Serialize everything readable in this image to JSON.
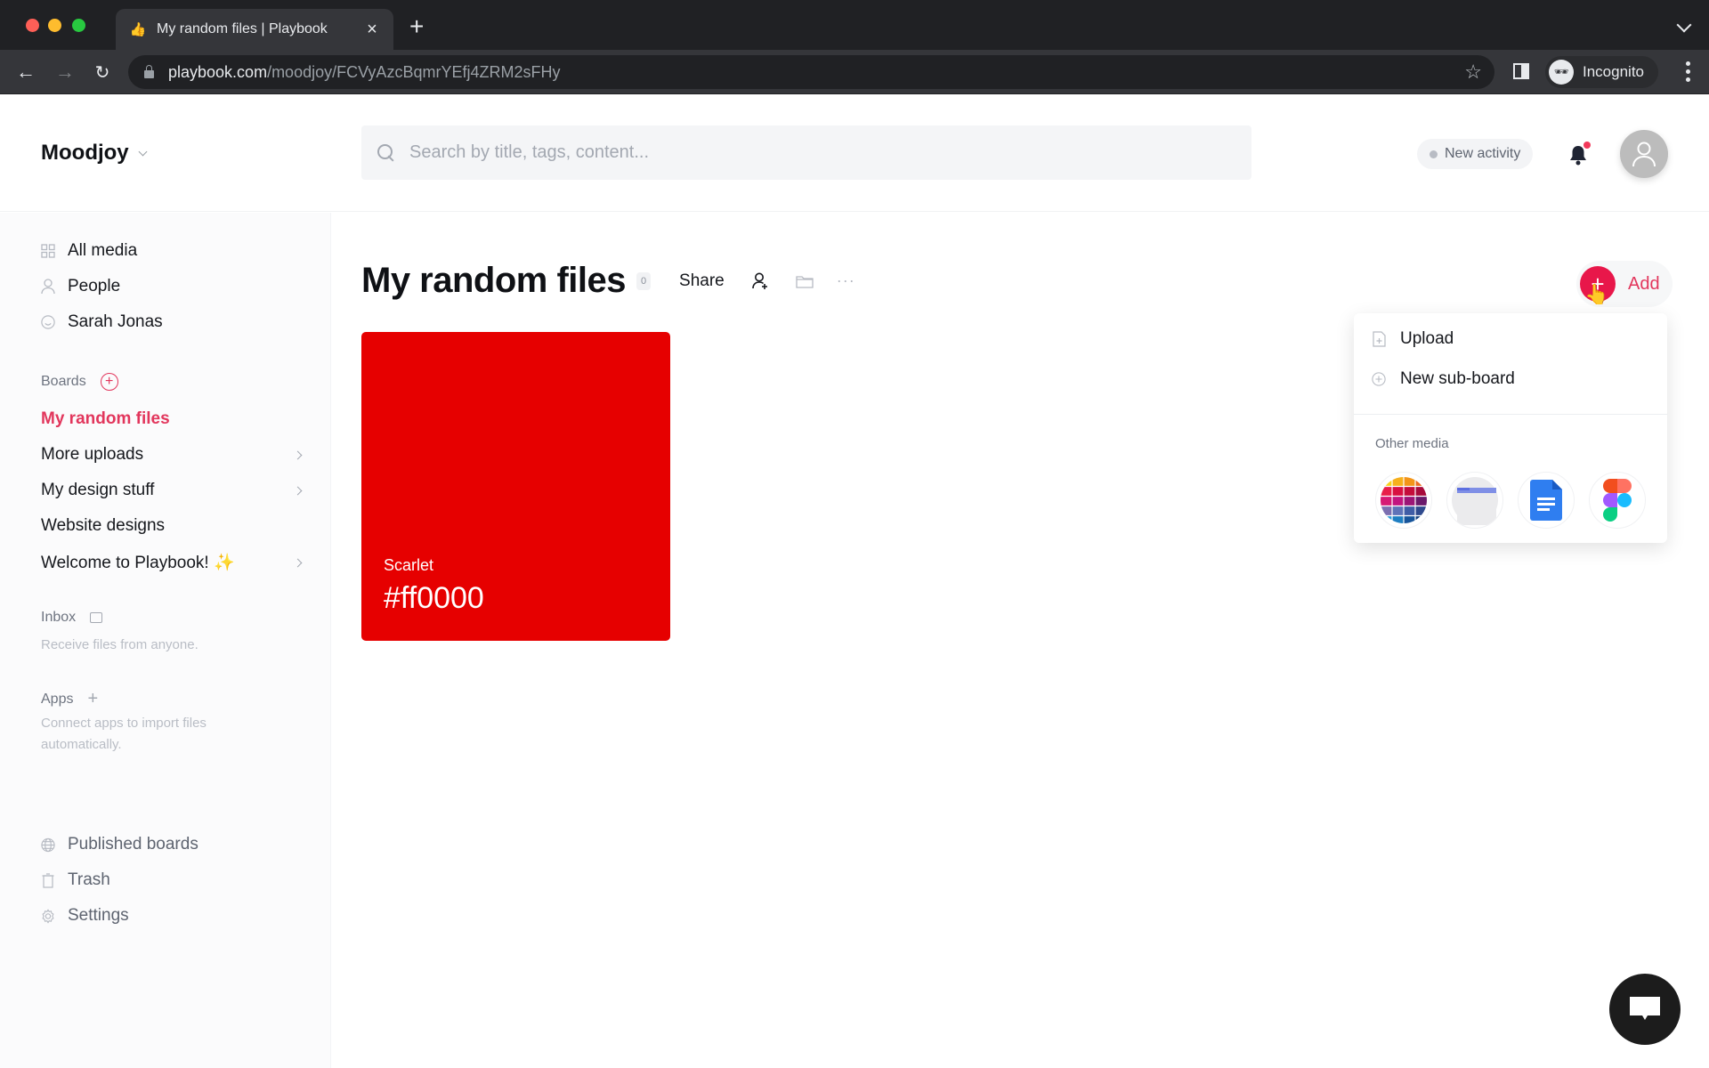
{
  "browser": {
    "tab_title": "My random files | Playbook",
    "tab_icon": "thumbs-up-icon",
    "url_host": "playbook.com",
    "url_path": "/moodjoy/FCVyAzcBqmrYEfj4ZRM2sFHy",
    "profile_label": "Incognito"
  },
  "header": {
    "workspace": "Moodjoy",
    "search_placeholder": "Search by title, tags, content...",
    "search_value": "",
    "activity_label": "New activity",
    "notification_unread": true
  },
  "sidebar": {
    "top_items": [
      {
        "label": "All media",
        "icon": "grid-icon"
      },
      {
        "label": "People",
        "icon": "person-icon"
      },
      {
        "label": "Sarah Jonas",
        "icon": "smiley-icon"
      }
    ],
    "boards_label": "Boards",
    "boards": [
      {
        "label": "My random files",
        "active": true,
        "has_children": false
      },
      {
        "label": "More uploads",
        "active": false,
        "has_children": true
      },
      {
        "label": "My design stuff",
        "active": false,
        "has_children": true
      },
      {
        "label": "Website designs",
        "active": false,
        "has_children": false
      },
      {
        "label": "Welcome to Playbook! ✨",
        "active": false,
        "has_children": true
      }
    ],
    "inbox_label": "Inbox",
    "inbox_hint": "Receive files from anyone.",
    "apps_label": "Apps",
    "apps_hint": "Connect apps to import files automatically.",
    "bottom_items": [
      {
        "label": "Published boards",
        "icon": "globe-icon"
      },
      {
        "label": "Trash",
        "icon": "trash-icon"
      },
      {
        "label": "Settings",
        "icon": "gear-icon"
      }
    ]
  },
  "board": {
    "title": "My random files",
    "count": "0",
    "share_label": "Share",
    "add_label": "Add",
    "items": [
      {
        "type": "color",
        "name": "Scarlet",
        "hex_label": "#ff0000",
        "swatch": "#e60000"
      }
    ]
  },
  "add_menu": {
    "items": [
      {
        "label": "Upload",
        "icon": "file-plus-icon"
      },
      {
        "label": "New sub-board",
        "icon": "circle-plus-icon"
      }
    ],
    "section_label": "Other media",
    "media": [
      {
        "name": "color-palette",
        "icon": "color-palette-icon"
      },
      {
        "name": "web-link",
        "icon": "browser-window-icon"
      },
      {
        "name": "google-docs",
        "icon": "google-docs-icon"
      },
      {
        "name": "figma",
        "icon": "figma-icon"
      }
    ]
  },
  "colors": {
    "accent": "#e2365c",
    "add_button": "#e8174a",
    "chrome_dark": "#202124"
  }
}
